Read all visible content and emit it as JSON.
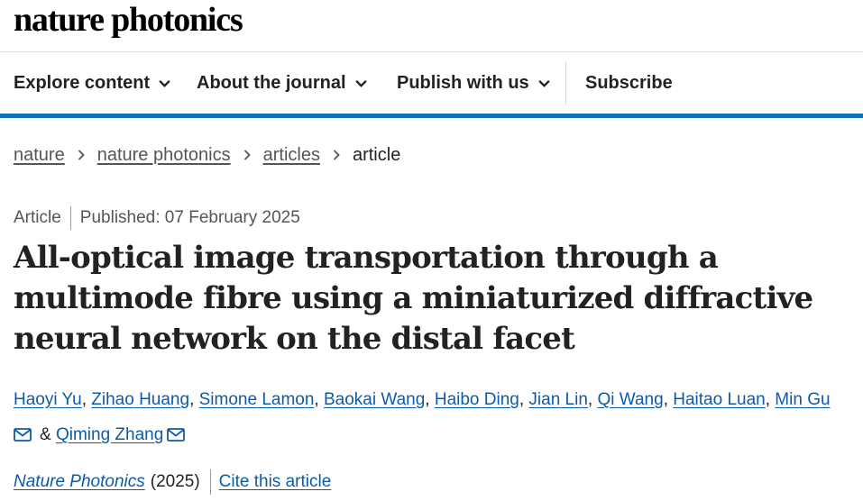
{
  "site": {
    "logo": "nature photonics"
  },
  "nav": {
    "items": [
      {
        "label": "Explore content",
        "dropdown": true
      },
      {
        "label": "About the journal",
        "dropdown": true
      },
      {
        "label": "Publish with us",
        "dropdown": true
      },
      {
        "label": "Subscribe",
        "dropdown": false
      }
    ],
    "accent_color": "#0e71b3"
  },
  "breadcrumb": {
    "items": [
      "nature",
      "nature photonics",
      "articles",
      "article"
    ]
  },
  "article": {
    "type": "Article",
    "published": "Published: 07 February 2025",
    "title": "All-optical image transportation through a multimode fibre using a miniaturized diffractive neural network on the distal facet",
    "authors": [
      {
        "name": "Haoyi Yu",
        "sep": ", "
      },
      {
        "name": "Zihao Huang",
        "sep": ", "
      },
      {
        "name": "Simone Lamon",
        "sep": ", "
      },
      {
        "name": "Baokai Wang",
        "sep": ", "
      },
      {
        "name": "Haibo Ding",
        "sep": ", "
      },
      {
        "name": "Jian Lin",
        "sep": ", "
      },
      {
        "name": "Qi Wang",
        "sep": ", "
      },
      {
        "name": "Haitao Luan",
        "sep": ", "
      },
      {
        "name": "Min Gu"
      }
    ],
    "and": "&",
    "last_author": "Qiming Zhang",
    "journal": "Nature Photonics",
    "year": "(2025)",
    "cite_label": "Cite this article",
    "link_color": "#0e5aa7"
  }
}
